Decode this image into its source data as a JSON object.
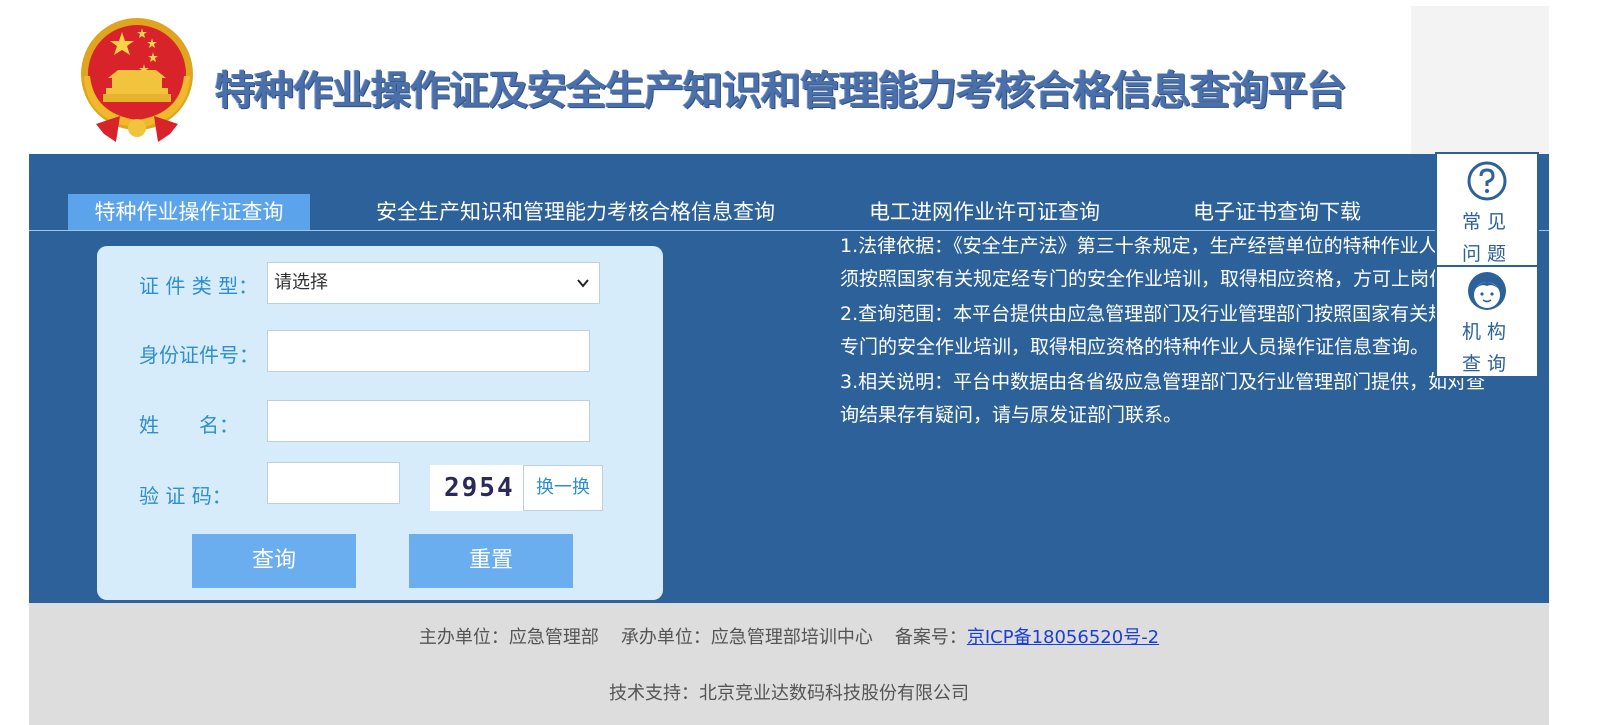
{
  "header": {
    "title": "特种作业操作证及安全生产知识和管理能力考核合格信息查询平台",
    "emblem_icon": "national-emblem-icon"
  },
  "tabs": [
    {
      "label": "特种作业操作证查询",
      "active": true
    },
    {
      "label": "安全生产知识和管理能力考核合格信息查询",
      "active": false
    },
    {
      "label": "电工进网作业许可证查询",
      "active": false
    },
    {
      "label": "电子证书查询下载",
      "active": false
    }
  ],
  "form": {
    "cert_type_label": "证 件 类 型：",
    "cert_type_value": "请选择",
    "id_label": "身份证件号：",
    "id_value": "",
    "name_label": "姓　　名：",
    "name_value": "",
    "captcha_label": "验 证 码：",
    "captcha_value": "",
    "captcha_image_text": "2954",
    "swap_label": "换一换",
    "query_label": "查询",
    "reset_label": "重置"
  },
  "notes": [
    "1.法律依据：《安全生产法》第三十条规定，生产经营单位的特种作业人员必须按照国家有关规定经专门的安全作业培训，取得相应资格，方可上岗作业。",
    "2.查询范围：本平台提供由应急管理部门及行业管理部门按照国家有关规定经专门的安全作业培训，取得相应资格的特种作业人员操作证信息查询。",
    "3.相关说明：平台中数据由各省级应急管理部门及行业管理部门提供，如对查询结果存有疑问，请与原发证部门联系。"
  ],
  "side_panel": {
    "faq_label_1": "常见",
    "faq_label_2": "问题",
    "faq_icon": "question-circle-icon",
    "org_label_1": "机构",
    "org_label_2": "查询",
    "org_icon": "agent-face-icon"
  },
  "footer": {
    "sponsor": "主办单位：应急管理部",
    "organizer": "承办单位：应急管理部培训中心",
    "icp_label": "备案号：",
    "icp_link": "京ICP备18056520号-2",
    "tech_support": "技术支持：北京竞业达数码科技股份有限公司"
  },
  "colors": {
    "primary_blue": "#2c6299",
    "active_tab": "#5ba4ec",
    "form_bg": "#d7ecfb",
    "button": "#6aaef0"
  }
}
